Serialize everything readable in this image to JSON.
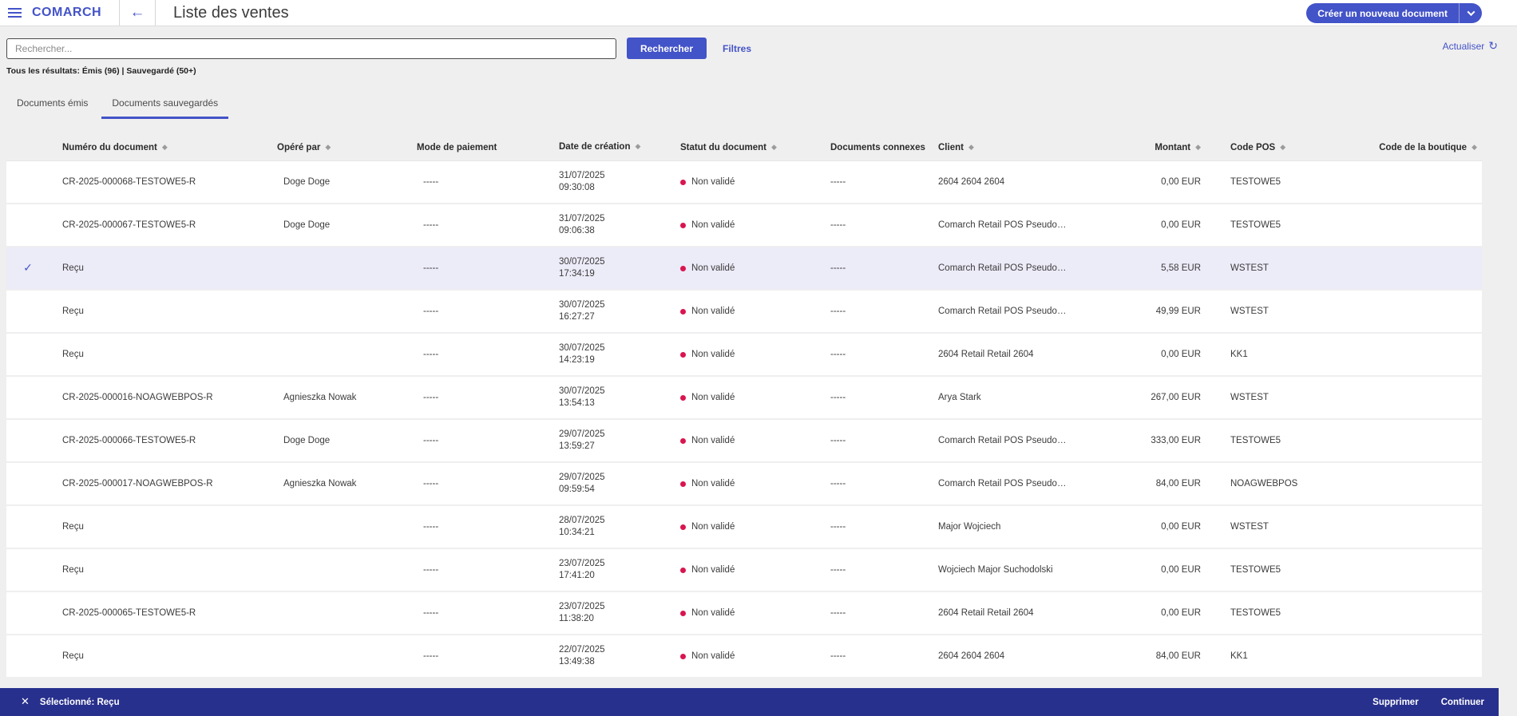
{
  "colors": {
    "accent": "#4353c8",
    "selection_bar": "#28308d",
    "status_dot": "#d9154f",
    "selected_row": "#ecebf8"
  },
  "header": {
    "logo": "COMARCH",
    "title": "Liste des ventes",
    "create_button_label": "Créer un nouveau document"
  },
  "toolbar": {
    "search_placeholder": "Rechercher...",
    "search_button": "Rechercher",
    "filters_link": "Filtres",
    "refresh_link": "Actualiser",
    "results_summary": "Tous les résultats: Émis (96) | Sauvegardé (50+)"
  },
  "tabs": [
    {
      "label": "Documents émis",
      "active": false
    },
    {
      "label": "Documents sauvegardés",
      "active": true
    }
  ],
  "table": {
    "columns": [
      {
        "key": "num",
        "label": "Numéro du document",
        "sortable": true
      },
      {
        "key": "operator",
        "label": "Opéré par",
        "sortable": true
      },
      {
        "key": "payment",
        "label": "Mode de paiement",
        "sortable": false
      },
      {
        "key": "date",
        "label": "Date de création",
        "sortable": true
      },
      {
        "key": "status",
        "label": "Statut du document",
        "sortable": true
      },
      {
        "key": "related",
        "label": "Documents connexes",
        "sortable": false
      },
      {
        "key": "client",
        "label": "Client",
        "sortable": true
      },
      {
        "key": "amount",
        "label": "Montant",
        "sortable": true
      },
      {
        "key": "pos",
        "label": "Code POS",
        "sortable": true
      },
      {
        "key": "shop",
        "label": "Code de la boutique",
        "sortable": true
      }
    ],
    "rows": [
      {
        "num": "CR-2025-000068-TESTOWE5-R",
        "operator": "Doge Doge",
        "payment": "-----",
        "date": "31/07/2025",
        "time": "09:30:08",
        "status": "Non validé",
        "related": "-----",
        "client": "2604 2604 2604",
        "amount": "0,00 EUR",
        "pos": "TESTOWE5",
        "shop": "",
        "selected": false
      },
      {
        "num": "CR-2025-000067-TESTOWE5-R",
        "operator": "Doge Doge",
        "payment": "-----",
        "date": "31/07/2025",
        "time": "09:06:38",
        "status": "Non validé",
        "related": "-----",
        "client": "Comarch Retail POS Pseudopa...",
        "amount": "0,00 EUR",
        "pos": "TESTOWE5",
        "shop": "",
        "selected": false
      },
      {
        "num": "Reçu",
        "operator": "",
        "payment": "-----",
        "date": "30/07/2025",
        "time": "17:34:19",
        "status": "Non validé",
        "related": "-----",
        "client": "Comarch Retail POS Pseudopa...",
        "amount": "5,58 EUR",
        "pos": "WSTEST",
        "shop": "",
        "selected": true
      },
      {
        "num": "Reçu",
        "operator": "",
        "payment": "-----",
        "date": "30/07/2025",
        "time": "16:27:27",
        "status": "Non validé",
        "related": "-----",
        "client": "Comarch Retail POS Pseudopa...",
        "amount": "49,99 EUR",
        "pos": "WSTEST",
        "shop": "",
        "selected": false
      },
      {
        "num": "Reçu",
        "operator": "",
        "payment": "-----",
        "date": "30/07/2025",
        "time": "14:23:19",
        "status": "Non validé",
        "related": "-----",
        "client": "2604 Retail Retail 2604",
        "amount": "0,00 EUR",
        "pos": "KK1",
        "shop": "",
        "selected": false
      },
      {
        "num": "CR-2025-000016-NOAGWEBPOS-R",
        "operator": "Agnieszka Nowak",
        "payment": "-----",
        "date": "30/07/2025",
        "time": "13:54:13",
        "status": "Non validé",
        "related": "-----",
        "client": "Arya Stark",
        "amount": "267,00 EUR",
        "pos": "WSTEST",
        "shop": "",
        "selected": false
      },
      {
        "num": "CR-2025-000066-TESTOWE5-R",
        "operator": "Doge Doge",
        "payment": "-----",
        "date": "29/07/2025",
        "time": "13:59:27",
        "status": "Non validé",
        "related": "-----",
        "client": "Comarch Retail POS Pseudopa...",
        "amount": "333,00 EUR",
        "pos": "TESTOWE5",
        "shop": "",
        "selected": false
      },
      {
        "num": "CR-2025-000017-NOAGWEBPOS-R",
        "operator": "Agnieszka Nowak",
        "payment": "-----",
        "date": "29/07/2025",
        "time": "09:59:54",
        "status": "Non validé",
        "related": "-----",
        "client": "Comarch Retail POS Pseudopa...",
        "amount": "84,00 EUR",
        "pos": "NOAGWEBPOS",
        "shop": "",
        "selected": false
      },
      {
        "num": "Reçu",
        "operator": "",
        "payment": "-----",
        "date": "28/07/2025",
        "time": "10:34:21",
        "status": "Non validé",
        "related": "-----",
        "client": "Major Wojciech",
        "amount": "0,00 EUR",
        "pos": "WSTEST",
        "shop": "",
        "selected": false
      },
      {
        "num": "Reçu",
        "operator": "",
        "payment": "-----",
        "date": "23/07/2025",
        "time": "17:41:20",
        "status": "Non validé",
        "related": "-----",
        "client": "Wojciech Major Suchodolski",
        "amount": "0,00 EUR",
        "pos": "TESTOWE5",
        "shop": "",
        "selected": false
      },
      {
        "num": "CR-2025-000065-TESTOWE5-R",
        "operator": "",
        "payment": "-----",
        "date": "23/07/2025",
        "time": "11:38:20",
        "status": "Non validé",
        "related": "-----",
        "client": "2604 Retail Retail 2604",
        "amount": "0,00 EUR",
        "pos": "TESTOWE5",
        "shop": "",
        "selected": false
      },
      {
        "num": "Reçu",
        "operator": "",
        "payment": "-----",
        "date": "22/07/2025",
        "time": "13:49:38",
        "status": "Non validé",
        "related": "-----",
        "client": "2604 2604 2604",
        "amount": "84,00 EUR",
        "pos": "KK1",
        "shop": "",
        "selected": false
      }
    ]
  },
  "selection_bar": {
    "label": "Sélectionné: Reçu",
    "delete_button": "Supprimer",
    "continue_button": "Continuer"
  },
  "icons": {
    "checkmark": "✓",
    "close": "✕",
    "refresh": "↻",
    "sort": "◆",
    "back_arrow": "←"
  }
}
